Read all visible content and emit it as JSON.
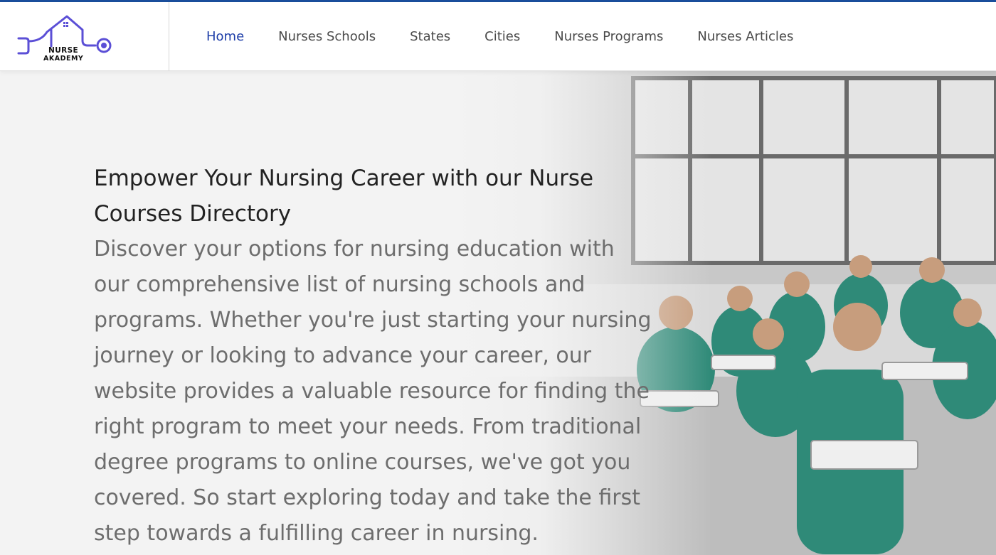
{
  "brand": {
    "logo_line1": "NURSE",
    "logo_line2": "AKADEMY",
    "accent_color": "#5b4fd6"
  },
  "nav": {
    "items": [
      {
        "label": "Home",
        "active": true
      },
      {
        "label": "Nurses Schools"
      },
      {
        "label": "States"
      },
      {
        "label": "Cities"
      },
      {
        "label": "Nurses Programs"
      },
      {
        "label": "Nurses Articles"
      }
    ],
    "active_color": "#1e3ea8",
    "top_accent_color": "#1a4f9c"
  },
  "hero": {
    "title": "Empower Your Nursing Career with our Nurse Courses Directory",
    "body": "Discover your options for nursing education with our comprehensive list of nursing schools and programs. Whether you're just starting your nursing journey or looking to advance your career, our website provides a valuable resource for finding the right program to meet your needs. From traditional degree programs to online courses, we've got you covered. So start exploring today and take the first step towards a fulfilling career in nursing.",
    "image": "classroom-of-nursing-students-in-green-scrubs"
  }
}
